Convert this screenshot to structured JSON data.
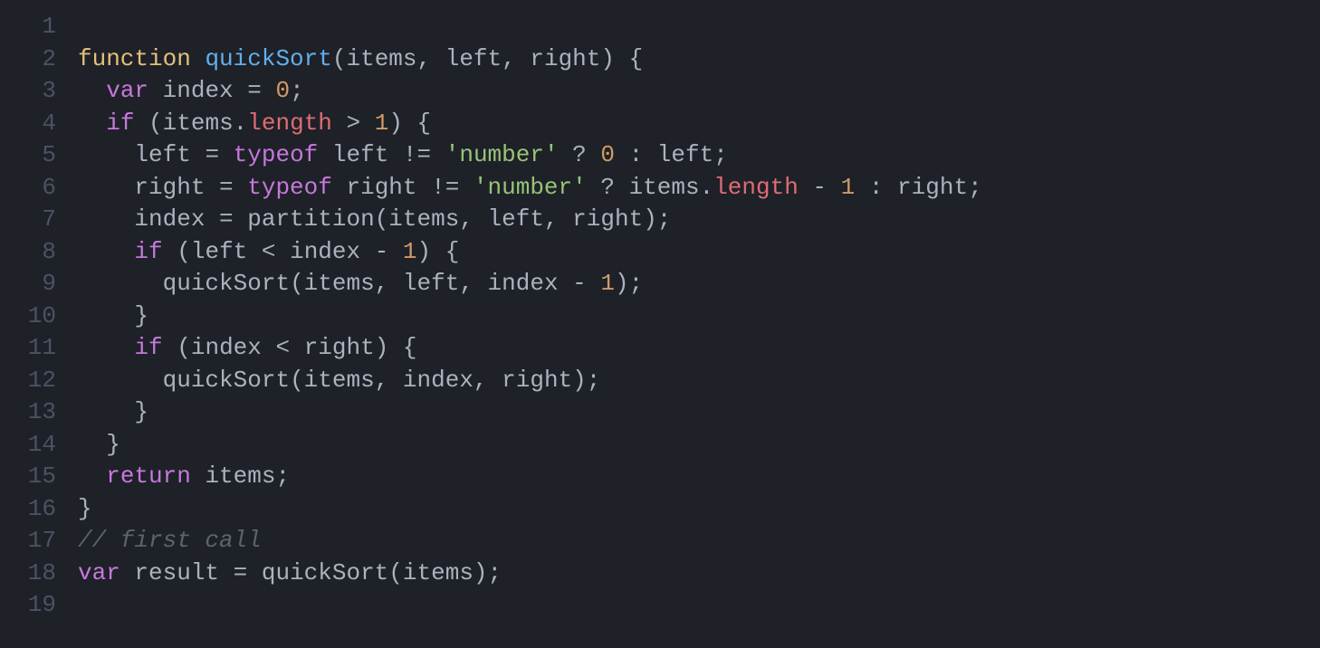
{
  "editor": {
    "lineNumbers": [
      "1",
      "2",
      "3",
      "4",
      "5",
      "6",
      "7",
      "8",
      "9",
      "10",
      "11",
      "12",
      "13",
      "14",
      "15",
      "16",
      "17",
      "18",
      "19"
    ],
    "lines": [
      {
        "tokens": []
      },
      {
        "tokens": [
          {
            "t": "function",
            "c": "yellow-kw"
          },
          {
            "t": " ",
            "c": ""
          },
          {
            "t": "quickSort",
            "c": "fn-name"
          },
          {
            "t": "(",
            "c": "paren"
          },
          {
            "t": "items",
            "c": "param"
          },
          {
            "t": ", ",
            "c": "punct"
          },
          {
            "t": "left",
            "c": "param"
          },
          {
            "t": ", ",
            "c": "punct"
          },
          {
            "t": "right",
            "c": "param"
          },
          {
            "t": ") ",
            "c": "paren"
          },
          {
            "t": "{",
            "c": "brace"
          }
        ]
      },
      {
        "indent": "  ",
        "tokens": [
          {
            "t": "var",
            "c": "var"
          },
          {
            "t": " ",
            "c": ""
          },
          {
            "t": "index",
            "c": "ident"
          },
          {
            "t": " = ",
            "c": "eq"
          },
          {
            "t": "0",
            "c": "num-lit"
          },
          {
            "t": ";",
            "c": "punct"
          }
        ]
      },
      {
        "indent": "  ",
        "tokens": [
          {
            "t": "if",
            "c": "kw"
          },
          {
            "t": " (",
            "c": "paren"
          },
          {
            "t": "items",
            "c": "ident"
          },
          {
            "t": ".",
            "c": "dot"
          },
          {
            "t": "length",
            "c": "prop"
          },
          {
            "t": " > ",
            "c": "op"
          },
          {
            "t": "1",
            "c": "num-lit"
          },
          {
            "t": ") ",
            "c": "paren"
          },
          {
            "t": "{",
            "c": "brace"
          }
        ]
      },
      {
        "indent": "    ",
        "tokens": [
          {
            "t": "left",
            "c": "ident"
          },
          {
            "t": " = ",
            "c": "eq"
          },
          {
            "t": "typeof",
            "c": "typeof"
          },
          {
            "t": " ",
            "c": ""
          },
          {
            "t": "left",
            "c": "ident"
          },
          {
            "t": " != ",
            "c": "op"
          },
          {
            "t": "'number'",
            "c": "str"
          },
          {
            "t": " ? ",
            "c": "op"
          },
          {
            "t": "0",
            "c": "num-lit"
          },
          {
            "t": " : ",
            "c": "op"
          },
          {
            "t": "left",
            "c": "ident"
          },
          {
            "t": ";",
            "c": "punct"
          }
        ]
      },
      {
        "indent": "    ",
        "tokens": [
          {
            "t": "right",
            "c": "ident"
          },
          {
            "t": " = ",
            "c": "eq"
          },
          {
            "t": "typeof",
            "c": "typeof"
          },
          {
            "t": " ",
            "c": ""
          },
          {
            "t": "right",
            "c": "ident"
          },
          {
            "t": " != ",
            "c": "op"
          },
          {
            "t": "'number'",
            "c": "str"
          },
          {
            "t": " ? ",
            "c": "op"
          },
          {
            "t": "items",
            "c": "ident"
          },
          {
            "t": ".",
            "c": "dot"
          },
          {
            "t": "length",
            "c": "prop"
          },
          {
            "t": " - ",
            "c": "op"
          },
          {
            "t": "1",
            "c": "num-lit"
          },
          {
            "t": " : ",
            "c": "op"
          },
          {
            "t": "right",
            "c": "ident"
          },
          {
            "t": ";",
            "c": "punct"
          }
        ]
      },
      {
        "indent": "    ",
        "tokens": [
          {
            "t": "index",
            "c": "ident"
          },
          {
            "t": " = ",
            "c": "eq"
          },
          {
            "t": "partition",
            "c": "call"
          },
          {
            "t": "(",
            "c": "paren"
          },
          {
            "t": "items",
            "c": "ident"
          },
          {
            "t": ", ",
            "c": "punct"
          },
          {
            "t": "left",
            "c": "ident"
          },
          {
            "t": ", ",
            "c": "punct"
          },
          {
            "t": "right",
            "c": "ident"
          },
          {
            "t": ")",
            "c": "paren"
          },
          {
            "t": ";",
            "c": "punct"
          }
        ]
      },
      {
        "indent": "    ",
        "tokens": [
          {
            "t": "if",
            "c": "kw"
          },
          {
            "t": " (",
            "c": "paren"
          },
          {
            "t": "left",
            "c": "ident"
          },
          {
            "t": " < ",
            "c": "op"
          },
          {
            "t": "index",
            "c": "ident"
          },
          {
            "t": " - ",
            "c": "op"
          },
          {
            "t": "1",
            "c": "num-lit"
          },
          {
            "t": ") ",
            "c": "paren"
          },
          {
            "t": "{",
            "c": "brace"
          }
        ]
      },
      {
        "indent": "      ",
        "tokens": [
          {
            "t": "quickSort",
            "c": "call"
          },
          {
            "t": "(",
            "c": "paren"
          },
          {
            "t": "items",
            "c": "ident"
          },
          {
            "t": ", ",
            "c": "punct"
          },
          {
            "t": "left",
            "c": "ident"
          },
          {
            "t": ", ",
            "c": "punct"
          },
          {
            "t": "index",
            "c": "ident"
          },
          {
            "t": " - ",
            "c": "op"
          },
          {
            "t": "1",
            "c": "num-lit"
          },
          {
            "t": ")",
            "c": "paren"
          },
          {
            "t": ";",
            "c": "punct"
          }
        ]
      },
      {
        "indent": "    ",
        "tokens": [
          {
            "t": "}",
            "c": "brace"
          }
        ]
      },
      {
        "indent": "    ",
        "tokens": [
          {
            "t": "if",
            "c": "kw"
          },
          {
            "t": " (",
            "c": "paren"
          },
          {
            "t": "index",
            "c": "ident"
          },
          {
            "t": " < ",
            "c": "op"
          },
          {
            "t": "right",
            "c": "ident"
          },
          {
            "t": ") ",
            "c": "paren"
          },
          {
            "t": "{",
            "c": "brace"
          }
        ]
      },
      {
        "indent": "      ",
        "tokens": [
          {
            "t": "quickSort",
            "c": "call"
          },
          {
            "t": "(",
            "c": "paren"
          },
          {
            "t": "items",
            "c": "ident"
          },
          {
            "t": ", ",
            "c": "punct"
          },
          {
            "t": "index",
            "c": "ident"
          },
          {
            "t": ", ",
            "c": "punct"
          },
          {
            "t": "right",
            "c": "ident"
          },
          {
            "t": ")",
            "c": "paren"
          },
          {
            "t": ";",
            "c": "punct"
          }
        ]
      },
      {
        "indent": "    ",
        "tokens": [
          {
            "t": "}",
            "c": "brace"
          }
        ]
      },
      {
        "indent": "  ",
        "tokens": [
          {
            "t": "}",
            "c": "brace"
          }
        ]
      },
      {
        "indent": "  ",
        "tokens": [
          {
            "t": "return",
            "c": "kw"
          },
          {
            "t": " ",
            "c": ""
          },
          {
            "t": "items",
            "c": "ident"
          },
          {
            "t": ";",
            "c": "punct"
          }
        ]
      },
      {
        "tokens": [
          {
            "t": "}",
            "c": "brace"
          }
        ]
      },
      {
        "tokens": [
          {
            "t": "// first call",
            "c": "cmt"
          }
        ]
      },
      {
        "tokens": [
          {
            "t": "var",
            "c": "var"
          },
          {
            "t": " ",
            "c": ""
          },
          {
            "t": "result",
            "c": "ident"
          },
          {
            "t": " = ",
            "c": "eq"
          },
          {
            "t": "quickSort",
            "c": "call"
          },
          {
            "t": "(",
            "c": "paren"
          },
          {
            "t": "items",
            "c": "ident"
          },
          {
            "t": ")",
            "c": "paren"
          },
          {
            "t": ";",
            "c": "punct"
          }
        ]
      },
      {
        "tokens": []
      }
    ]
  },
  "colors": {
    "bg": "#1e2127",
    "gutter": "#4b5263",
    "default": "#abb2bf",
    "keyword": "#c678dd",
    "funcdef": "#e5c07b",
    "funcname": "#61afef",
    "number": "#d19a66",
    "string": "#98c379",
    "prop": "#e06c75",
    "comment": "#5c6370"
  }
}
